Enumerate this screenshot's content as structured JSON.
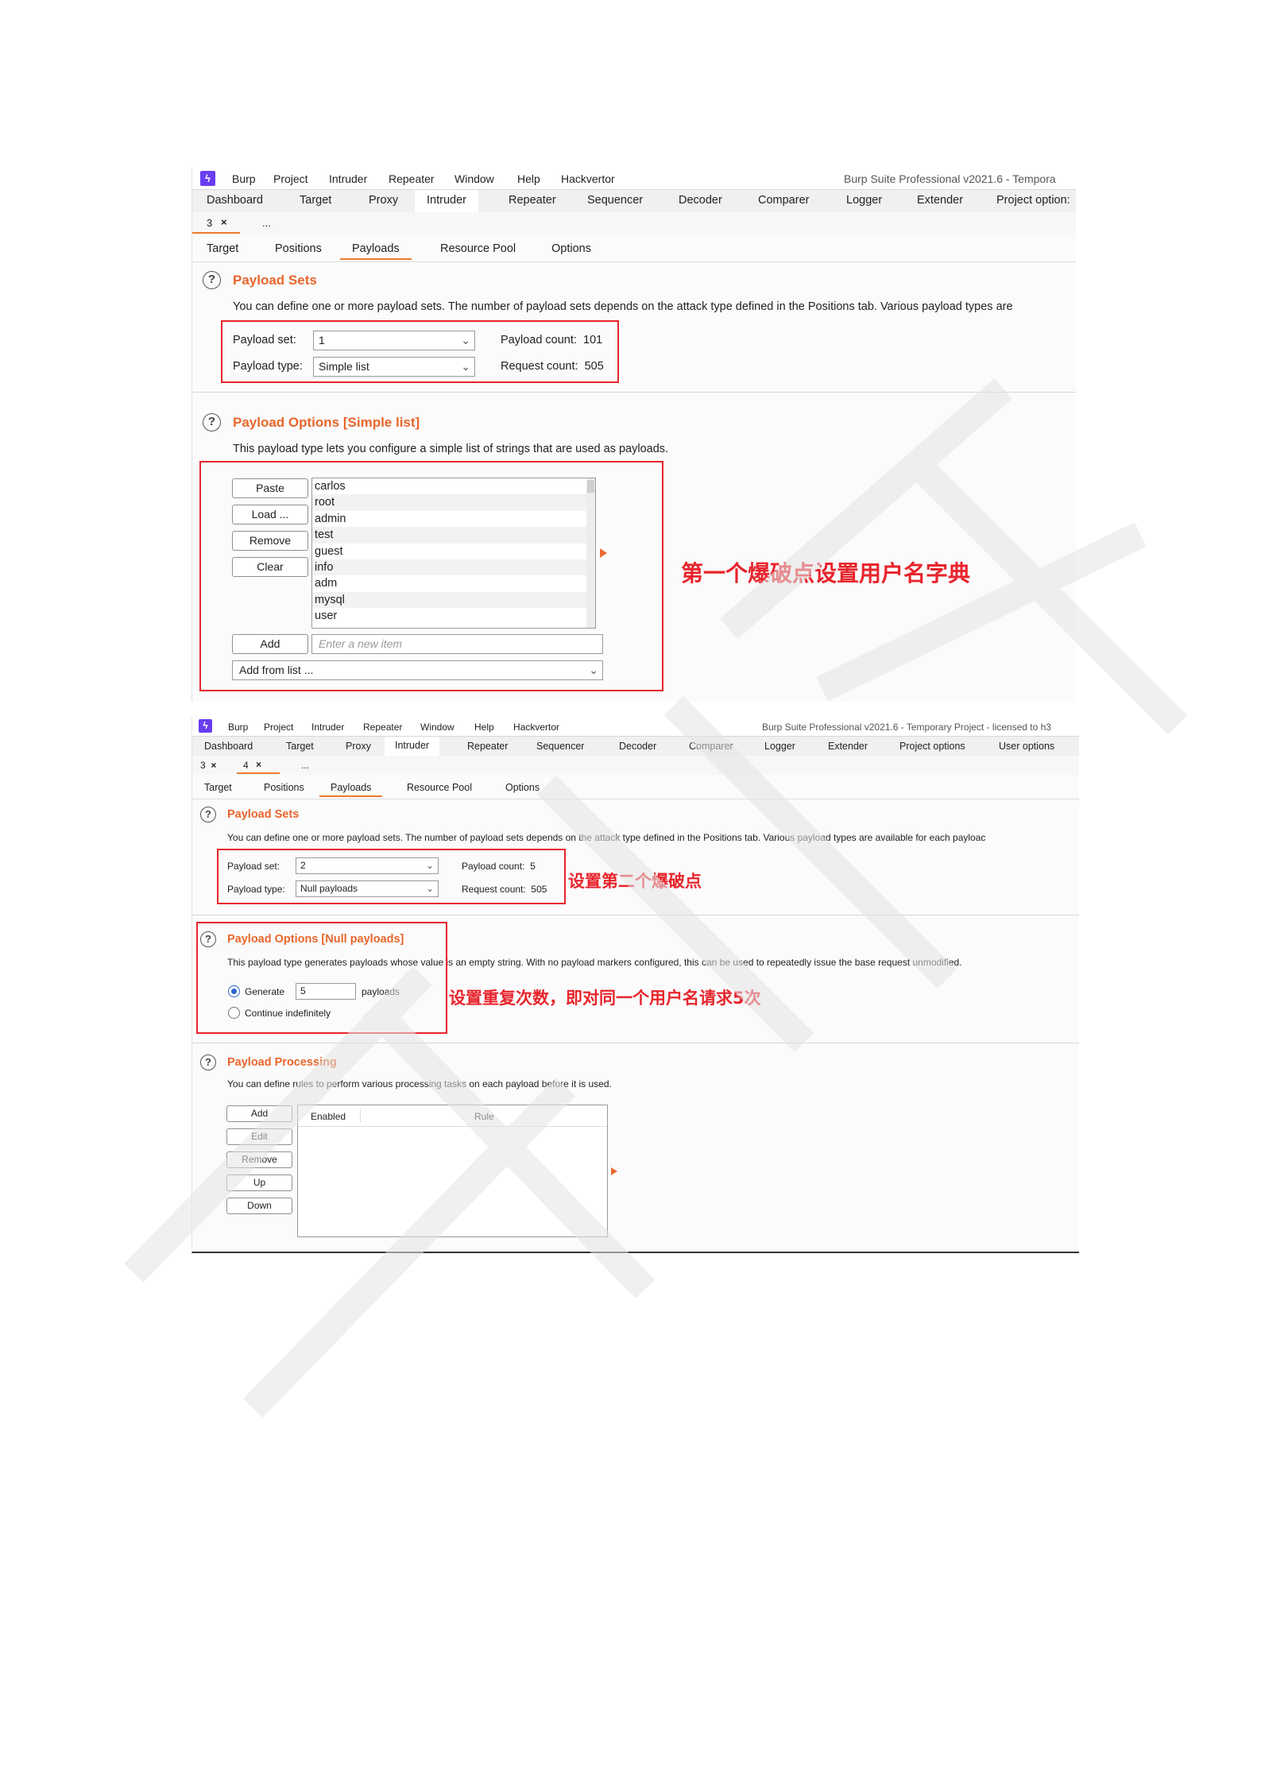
{
  "screenshot1": {
    "menu": [
      "Burp",
      "Project",
      "Intruder",
      "Repeater",
      "Window",
      "Help",
      "Hackvertor"
    ],
    "window_title": "Burp Suite Professional v2021.6 - Tempora",
    "tabs": [
      "Dashboard",
      "Target",
      "Proxy",
      "Intruder",
      "Repeater",
      "Sequencer",
      "Decoder",
      "Comparer",
      "Logger",
      "Extender",
      "Project option:"
    ],
    "active_tab": "Intruder",
    "attack_tab": {
      "label": "3",
      "close": "×",
      "more": "..."
    },
    "inner_tabs": [
      "Target",
      "Positions",
      "Payloads",
      "Resource Pool",
      "Options"
    ],
    "active_inner_tab": "Payloads",
    "payload_sets": {
      "help": "?",
      "title": "Payload Sets",
      "description": "You can define one or more payload sets. The number of payload sets depends on the attack type defined in the Positions tab. Various payload types are",
      "payload_set_label": "Payload set:",
      "payload_set_value": "1",
      "payload_type_label": "Payload type:",
      "payload_type_value": "Simple list",
      "payload_count_label": "Payload count:",
      "payload_count_value": "101",
      "request_count_label": "Request count:",
      "request_count_value": "505"
    },
    "payload_options": {
      "help": "?",
      "title": "Payload Options [Simple list]",
      "description": "This payload type lets you configure a simple list of strings that are used as payloads.",
      "buttons": [
        "Paste",
        "Load ...",
        "Remove",
        "Clear"
      ],
      "items": [
        "carlos",
        "root",
        "admin",
        "test",
        "guest",
        "info",
        "adm",
        "mysql",
        "user"
      ],
      "add_button": "Add",
      "new_item_placeholder": "Enter a new item",
      "add_from_list": "Add from list ..."
    },
    "annotation": "第一个爆破点设置用户名字典"
  },
  "screenshot2": {
    "menu": [
      "Burp",
      "Project",
      "Intruder",
      "Repeater",
      "Window",
      "Help",
      "Hackvertor"
    ],
    "window_title": "Burp Suite Professional v2021.6 - Temporary Project - licensed to h3",
    "tabs": [
      "Dashboard",
      "Target",
      "Proxy",
      "Intruder",
      "Repeater",
      "Sequencer",
      "Decoder",
      "Comparer",
      "Logger",
      "Extender",
      "Project options",
      "User options"
    ],
    "active_tab": "Intruder",
    "attack_tabs": [
      {
        "label": "3",
        "close": "×"
      },
      {
        "label": "4",
        "close": "×"
      }
    ],
    "attack_more": "...",
    "inner_tabs": [
      "Target",
      "Positions",
      "Payloads",
      "Resource Pool",
      "Options"
    ],
    "active_inner_tab": "Payloads",
    "payload_sets": {
      "help": "?",
      "title": "Payload Sets",
      "description": "You can define one or more payload sets. The number of payload sets depends on the attack type defined in the Positions tab. Various payload types are available for each payloac",
      "payload_set_label": "Payload set:",
      "payload_set_value": "2",
      "payload_type_label": "Payload type:",
      "payload_type_value": "Null payloads",
      "payload_count_label": "Payload count:",
      "payload_count_value": "5",
      "request_count_label": "Request count:",
      "request_count_value": "505"
    },
    "annotation_1": "设置第二个爆破点",
    "payload_options": {
      "help": "?",
      "title": "Payload Options [Null payloads]",
      "description": "This payload type generates payloads whose value is an empty string. With no payload markers configured, this can be used to repeatedly issue the base request unmodified.",
      "generate_label": "Generate",
      "generate_value": "5",
      "payloads_label": "payloads",
      "continue_label": "Continue indefinitely"
    },
    "annotation_2": "设置重复次数，即对同一个用户名请求5次",
    "payload_processing": {
      "help": "?",
      "title": "Payload Processing",
      "description": "You can define rules to perform various processing tasks on each payload before it is used.",
      "buttons": [
        "Add",
        "Edit",
        "Remove",
        "Up",
        "Down"
      ],
      "columns": [
        "Enabled",
        "Rule"
      ]
    }
  },
  "colors": {
    "accent": "#ee7a2f",
    "annotation_red": "#e8242c",
    "burp_logo": "#6a3df0"
  },
  "icons": {
    "logo": "burp-logo-icon",
    "chevron": "chevron-down-icon",
    "help": "help-circle-icon",
    "arrow": "triangle-right-icon"
  }
}
